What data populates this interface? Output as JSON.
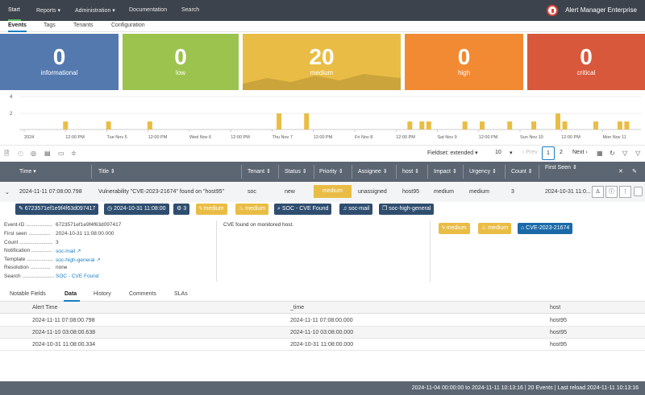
{
  "nav": {
    "items": [
      "Start",
      "Reports ▾",
      "Administration ▾",
      "Documentation",
      "Search"
    ],
    "brand": "Alert Manager Enterprise"
  },
  "subnav": {
    "items": [
      "Events",
      "Tags",
      "Tenants",
      "Configuration"
    ]
  },
  "cards": [
    {
      "value": "0",
      "label": "informational",
      "color": "#5379af"
    },
    {
      "value": "0",
      "label": "low",
      "color": "#9cc34e"
    },
    {
      "value": "20",
      "label": "medium",
      "color": "#e9bd45"
    },
    {
      "value": "0",
      "label": "high",
      "color": "#f28a33"
    },
    {
      "value": "0",
      "label": "critical",
      "color": "#d8583c"
    }
  ],
  "chart_data": {
    "type": "bar",
    "ylim": [
      0,
      4
    ],
    "yticks": [
      "4",
      "2"
    ],
    "xticks": [
      "2024",
      "12:00 PM",
      "Tue Nov 5",
      "12:00 PM",
      "Wed Nov 6",
      "12:00 PM",
      "Thu Nov 7",
      "12:00 PM",
      "Fri Nov 8",
      "12:00 PM",
      "Sat Nov 9",
      "12:00 PM",
      "Sun Nov 10",
      "12:00 PM",
      "Mon Nov 11"
    ],
    "x": [
      "2024-11-04 12:00",
      "2024-11-05 00:30",
      "2024-11-05 12:30",
      "2024-11-07 02:00",
      "2024-11-07 10:00",
      "2024-11-08 16:00",
      "2024-11-08 19:30",
      "2024-11-08 21:30",
      "2024-11-09 08:00",
      "2024-11-09 13:00",
      "2024-11-09 21:00",
      "2024-11-10 04:00",
      "2024-11-10 11:00",
      "2024-11-10 13:00",
      "2024-11-10 22:00",
      "2024-11-11 05:00",
      "2024-11-11 07:00"
    ],
    "values": [
      1,
      1,
      1,
      2,
      2,
      1,
      1,
      1,
      1,
      1,
      1,
      1,
      2,
      1,
      1,
      1,
      1
    ],
    "color": "#e9bd45"
  },
  "toolbar": {
    "fieldset": "Fieldset: extended ▾",
    "page_size": "10",
    "page_size_caret": "▾",
    "prev": "‹ Prev",
    "pages": [
      "1",
      "2"
    ],
    "next": "Next ›"
  },
  "table": {
    "headers": [
      "Time ▾",
      "Title ⇕",
      "Tenant ⇕",
      "Status ⇕",
      "Priority ⇕",
      "Assignee ⇕",
      "host ⇕",
      "Impact ⇕",
      "Urgency ⇕",
      "Count ⇕",
      "First Seen ⇕"
    ],
    "row": {
      "time": "2024-11-11 07:08:00.798",
      "title": "Vulnerability \"CVE-2023-21674\" found on \"host95\"",
      "tenant": "soc",
      "status": "new",
      "priority": "medium",
      "assignee": "unassigned",
      "host": "host95",
      "impact": "medium",
      "urgency": "medium",
      "count": "3",
      "first_seen": "2024-10-31 11:0..."
    }
  },
  "tags": [
    "✎ 6723571ef1e9f4f63d097417",
    "◷ 2024-10-31 11:08:00",
    "⚙ 3",
    "ϟ medium",
    "♨ medium",
    "⌕ SOC - CVE Found",
    "♫ soc-mail",
    "❐ soc-high-general"
  ],
  "details": {
    "labels": [
      "Event-ID ..................",
      "First seen ...............",
      "Count .......................",
      "Notification ..............",
      "Template ..................",
      "Resolution ..............",
      "Search ......................"
    ],
    "values": [
      "6723571ef1e9f4f63d097417",
      "2024-10-31 11:08:00.000",
      "3",
      "soc-mail ↗",
      "soc-high-general ↗",
      "none",
      "SOC - CVE Found"
    ],
    "description": "CVE found on monitored host.",
    "badges": [
      "ϟ medium",
      "♨ medium",
      "⌂ CVE-2023-21674"
    ]
  },
  "tabs": [
    "Notable Fields",
    "Data",
    "History",
    "Comments",
    "SLAs"
  ],
  "data_table": {
    "headers": [
      "Alert Time",
      "_time",
      "host"
    ],
    "rows": [
      [
        "2024-11-11 07:08:00.798",
        "2024-11-11 07:08:00.000",
        "host95"
      ],
      [
        "2024-11-10 03:08:00.638",
        "2024-11-10 03:08:00.000",
        "host95"
      ],
      [
        "2024-10-31 11:08:00.334",
        "2024-10-31 11:08:00.000",
        "host95"
      ]
    ]
  },
  "footer": "2024-11-04 00:00:00 to 2024-11-11 10:13:16  |  20 Events  |  Last reload 2024-11-11 10:13:16"
}
